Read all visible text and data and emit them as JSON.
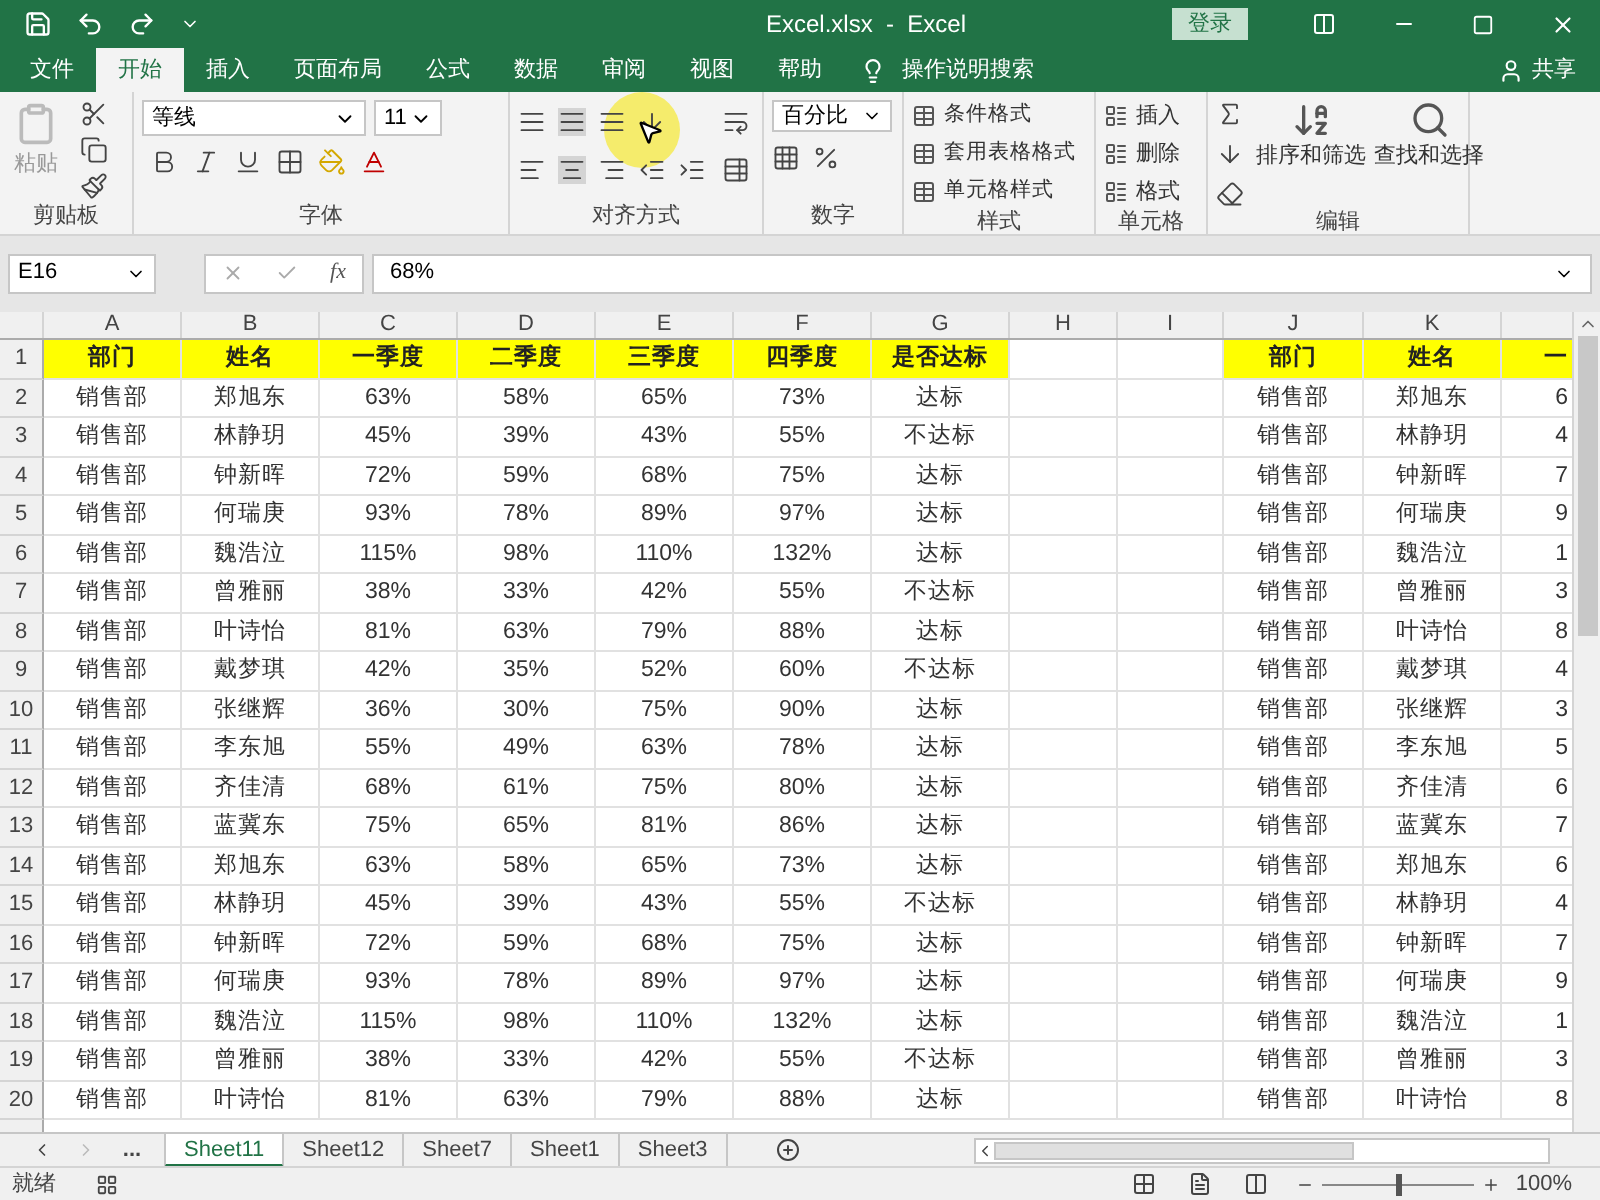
{
  "window": {
    "title": "Excel.xlsx  -  Excel",
    "login": "登录"
  },
  "ribbon_tabs": [
    {
      "label": "文件",
      "selected": false
    },
    {
      "label": "开始",
      "selected": true
    },
    {
      "label": "插入",
      "selected": false
    },
    {
      "label": "页面布局",
      "selected": false
    },
    {
      "label": "公式",
      "selected": false
    },
    {
      "label": "数据",
      "selected": false
    },
    {
      "label": "审阅",
      "selected": false
    },
    {
      "label": "视图",
      "selected": false
    },
    {
      "label": "帮助",
      "selected": false
    }
  ],
  "tell_me": "操作说明搜索",
  "share": "共享",
  "ribbon": {
    "clipboard": {
      "paste": "粘贴",
      "label": "剪贴板"
    },
    "font": {
      "name": "等线",
      "size": "11",
      "label": "字体"
    },
    "alignment": {
      "label": "对齐方式"
    },
    "number": {
      "format": "百分比",
      "label": "数字"
    },
    "styles": {
      "items": [
        "条件格式",
        "套用表格格式",
        "单元格样式"
      ],
      "label": "样式"
    },
    "cells": {
      "items": [
        "插入",
        "删除",
        "格式"
      ],
      "label": "单元格"
    },
    "editing": {
      "items": [
        "排序和筛选",
        "查找和选择"
      ],
      "label": "编辑"
    }
  },
  "formula_bar": {
    "name_box": "E16",
    "fx": "fx",
    "value": "68%"
  },
  "columns": [
    "A",
    "B",
    "C",
    "D",
    "E",
    "F",
    "G",
    "H",
    "I",
    "J",
    "K"
  ],
  "header_row": {
    "number": "1",
    "cells": [
      "部门",
      "姓名",
      "一季度",
      "二季度",
      "三季度",
      "四季度",
      "是否达标"
    ],
    "mirror_cells": [
      "部门",
      "姓名",
      "一"
    ]
  },
  "rows": [
    {
      "number": "2",
      "cells": [
        "销售部",
        "郑旭东",
        "63%",
        "58%",
        "65%",
        "73%",
        "达标"
      ],
      "mirror_cells": [
        "销售部",
        "郑旭东",
        "6"
      ]
    },
    {
      "number": "3",
      "cells": [
        "销售部",
        "林静玥",
        "45%",
        "39%",
        "43%",
        "55%",
        "不达标"
      ],
      "mirror_cells": [
        "销售部",
        "林静玥",
        "4"
      ]
    },
    {
      "number": "4",
      "cells": [
        "销售部",
        "钟新晖",
        "72%",
        "59%",
        "68%",
        "75%",
        "达标"
      ],
      "mirror_cells": [
        "销售部",
        "钟新晖",
        "7"
      ]
    },
    {
      "number": "5",
      "cells": [
        "销售部",
        "何瑞庚",
        "93%",
        "78%",
        "89%",
        "97%",
        "达标"
      ],
      "mirror_cells": [
        "销售部",
        "何瑞庚",
        "9"
      ]
    },
    {
      "number": "6",
      "cells": [
        "销售部",
        "魏浩泣",
        "115%",
        "98%",
        "110%",
        "132%",
        "达标"
      ],
      "mirror_cells": [
        "销售部",
        "魏浩泣",
        "1"
      ]
    },
    {
      "number": "7",
      "cells": [
        "销售部",
        "曾雅丽",
        "38%",
        "33%",
        "42%",
        "55%",
        "不达标"
      ],
      "mirror_cells": [
        "销售部",
        "曾雅丽",
        "3"
      ]
    },
    {
      "number": "8",
      "cells": [
        "销售部",
        "叶诗怡",
        "81%",
        "63%",
        "79%",
        "88%",
        "达标"
      ],
      "mirror_cells": [
        "销售部",
        "叶诗怡",
        "8"
      ]
    },
    {
      "number": "9",
      "cells": [
        "销售部",
        "戴梦琪",
        "42%",
        "35%",
        "52%",
        "60%",
        "不达标"
      ],
      "mirror_cells": [
        "销售部",
        "戴梦琪",
        "4"
      ]
    },
    {
      "number": "10",
      "cells": [
        "销售部",
        "张继辉",
        "36%",
        "30%",
        "75%",
        "90%",
        "达标"
      ],
      "mirror_cells": [
        "销售部",
        "张继辉",
        "3"
      ]
    },
    {
      "number": "11",
      "cells": [
        "销售部",
        "李东旭",
        "55%",
        "49%",
        "63%",
        "78%",
        "达标"
      ],
      "mirror_cells": [
        "销售部",
        "李东旭",
        "5"
      ]
    },
    {
      "number": "12",
      "cells": [
        "销售部",
        "齐佳清",
        "68%",
        "61%",
        "75%",
        "80%",
        "达标"
      ],
      "mirror_cells": [
        "销售部",
        "齐佳清",
        "6"
      ]
    },
    {
      "number": "13",
      "cells": [
        "销售部",
        "蓝冀东",
        "75%",
        "65%",
        "81%",
        "86%",
        "达标"
      ],
      "mirror_cells": [
        "销售部",
        "蓝冀东",
        "7"
      ]
    },
    {
      "number": "14",
      "cells": [
        "销售部",
        "郑旭东",
        "63%",
        "58%",
        "65%",
        "73%",
        "达标"
      ],
      "mirror_cells": [
        "销售部",
        "郑旭东",
        "6"
      ]
    },
    {
      "number": "15",
      "cells": [
        "销售部",
        "林静玥",
        "45%",
        "39%",
        "43%",
        "55%",
        "不达标"
      ],
      "mirror_cells": [
        "销售部",
        "林静玥",
        "4"
      ]
    },
    {
      "number": "16",
      "cells": [
        "销售部",
        "钟新晖",
        "72%",
        "59%",
        "68%",
        "75%",
        "达标"
      ],
      "mirror_cells": [
        "销售部",
        "钟新晖",
        "7"
      ]
    },
    {
      "number": "17",
      "cells": [
        "销售部",
        "何瑞庚",
        "93%",
        "78%",
        "89%",
        "97%",
        "达标"
      ],
      "mirror_cells": [
        "销售部",
        "何瑞庚",
        "9"
      ]
    },
    {
      "number": "18",
      "cells": [
        "销售部",
        "魏浩泣",
        "115%",
        "98%",
        "110%",
        "132%",
        "达标"
      ],
      "mirror_cells": [
        "销售部",
        "魏浩泣",
        "1"
      ]
    },
    {
      "number": "19",
      "cells": [
        "销售部",
        "曾雅丽",
        "38%",
        "33%",
        "42%",
        "55%",
        "不达标"
      ],
      "mirror_cells": [
        "销售部",
        "曾雅丽",
        "3"
      ]
    },
    {
      "number": "20",
      "cells": [
        "销售部",
        "叶诗怡",
        "81%",
        "63%",
        "79%",
        "88%",
        "达标"
      ],
      "mirror_cells": [
        "销售部",
        "叶诗怡",
        "8"
      ]
    }
  ],
  "sheet_tabs": {
    "more": "...",
    "tabs": [
      {
        "label": "Sheet11",
        "selected": true
      },
      {
        "label": "Sheet12",
        "selected": false
      },
      {
        "label": "Sheet7",
        "selected": false
      },
      {
        "label": "Sheet1",
        "selected": false
      },
      {
        "label": "Sheet3",
        "selected": false
      }
    ]
  },
  "status_bar": {
    "status": "就绪",
    "zoom": {
      "level": 0.5,
      "reading": "100%"
    }
  }
}
